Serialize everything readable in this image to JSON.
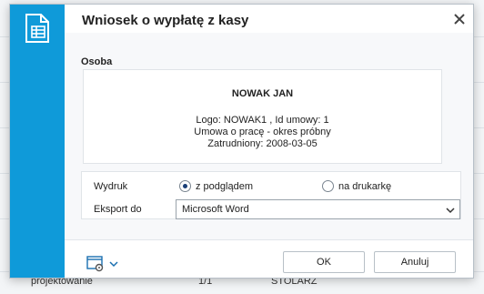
{
  "background": {
    "bottom_cells": [
      "projektowanie",
      "1/1",
      "STOLARZ"
    ]
  },
  "dialog": {
    "title": "Wniosek o wypłatę z kasy",
    "close_icon": "close-icon",
    "side_icon": "spreadsheet-document-icon",
    "person_section": {
      "label": "Osoba",
      "name": "NOWAK JAN",
      "lines": [
        "Logo: NOWAK1 , Id umowy: 1",
        "Umowa o pracę - okres próbny",
        "Zatrudniony: 2008-03-05"
      ]
    },
    "print": {
      "label": "Wydruk",
      "options": [
        {
          "label": "z podglądem",
          "checked": true
        },
        {
          "label": "na drukarkę",
          "checked": false
        }
      ]
    },
    "export": {
      "label": "Eksport do",
      "selected": "Microsoft Word"
    },
    "footer": {
      "settings_icon": "window-settings-icon",
      "menu_icon": "chevron-down-icon",
      "ok_label": "OK",
      "cancel_label": "Anuluj"
    },
    "colors": {
      "accent": "#0f9ad9",
      "radio_dot": "#1a3f77"
    }
  }
}
